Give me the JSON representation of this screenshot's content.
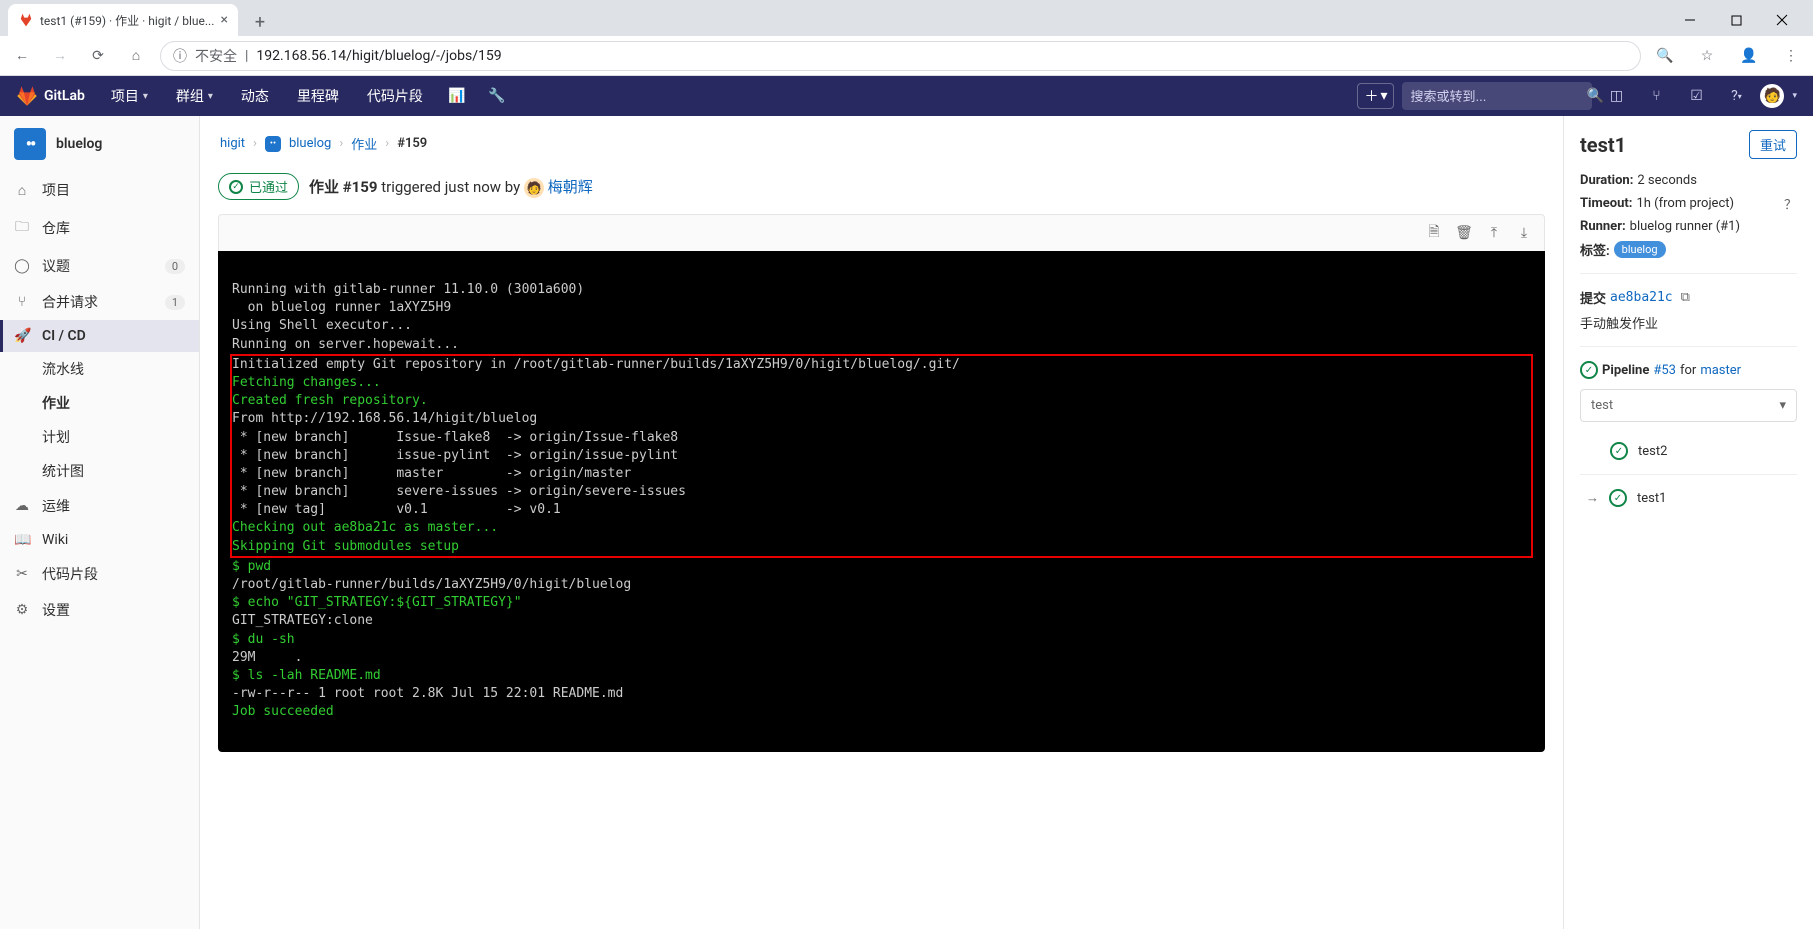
{
  "browser": {
    "tab_title": "test1 (#159) · 作业 · higit / blue...",
    "url_insecure_label": "不安全",
    "url": "192.168.56.14/higit/bluelog/-/jobs/159"
  },
  "gitlab_header": {
    "brand": "GitLab",
    "nav": {
      "projects": "项目",
      "groups": "群组",
      "activity": "动态",
      "milestones": "里程碑",
      "snippets": "代码片段"
    },
    "search_placeholder": "搜索或转到..."
  },
  "sidebar": {
    "project_name": "bluelog",
    "items": {
      "project": "项目",
      "repository": "仓库",
      "issues": "议题",
      "issues_count": "0",
      "merge_requests": "合并请求",
      "mr_count": "1",
      "cicd": "CI / CD",
      "operations": "运维",
      "wiki": "Wiki",
      "snippets": "代码片段",
      "settings": "设置"
    },
    "cicd_sub": {
      "pipelines": "流水线",
      "jobs": "作业",
      "schedules": "计划",
      "charts": "统计图"
    }
  },
  "breadcrumb": {
    "group": "higit",
    "project": "bluelog",
    "section": "作业",
    "job_id": "#159"
  },
  "job": {
    "status_text": "已通过",
    "title_prefix": "作业",
    "title_id": "#159",
    "triggered_text": "triggered just now by",
    "user": "梅朝辉"
  },
  "terminal": {
    "pre1": "Running with gitlab-runner 11.10.0 (3001a600)\n  on bluelog runner 1aXYZ5H9\nUsing Shell executor...\nRunning on server.hopewait...",
    "box_l1": "Initialized empty Git repository in /root/gitlab-runner/builds/1aXYZ5H9/0/higit/bluelog/.git/",
    "box_g1": "Fetching changes...",
    "box_g2": "Created fresh repository.",
    "box_l2": "From http://192.168.56.14/higit/bluelog\n * [new branch]      Issue-flake8  -> origin/Issue-flake8\n * [new branch]      issue-pylint  -> origin/issue-pylint\n * [new branch]      master        -> origin/master\n * [new branch]      severe-issues -> origin/severe-issues\n * [new tag]         v0.1          -> v0.1",
    "box_g3": "Checking out ae8ba21c as master...",
    "box_g4": "Skipping Git submodules setup",
    "cmd1_prompt": "$ pwd",
    "cmd1_out": "/root/gitlab-runner/builds/1aXYZ5H9/0/higit/bluelog",
    "cmd2_prompt": "$ echo \"GIT_STRATEGY:${GIT_STRATEGY}\"",
    "cmd2_out": "GIT_STRATEGY:clone",
    "cmd3_prompt": "$ du -sh",
    "cmd3_out": "29M     .",
    "cmd4_prompt": "$ ls -lah README.md",
    "cmd4_out": "-rw-r--r-- 1 root root 2.8K Jul 15 22:01 README.md",
    "success": "Job succeeded"
  },
  "right": {
    "title": "test1",
    "retry": "重试",
    "duration_label": "Duration:",
    "duration_value": "2 seconds",
    "timeout_label": "Timeout:",
    "timeout_value": "1h (from project)",
    "runner_label": "Runner:",
    "runner_value": "bluelog runner (#1)",
    "tags_label": "标签:",
    "tag": "bluelog",
    "commit_label": "提交",
    "commit_sha": "ae8ba21c",
    "trigger_text": "手动触发作业",
    "pipeline_label": "Pipeline",
    "pipeline_id": "#53",
    "pipeline_for": "for",
    "pipeline_branch": "master",
    "stage_selected": "test",
    "job_other": "test2",
    "job_current": "test1"
  }
}
